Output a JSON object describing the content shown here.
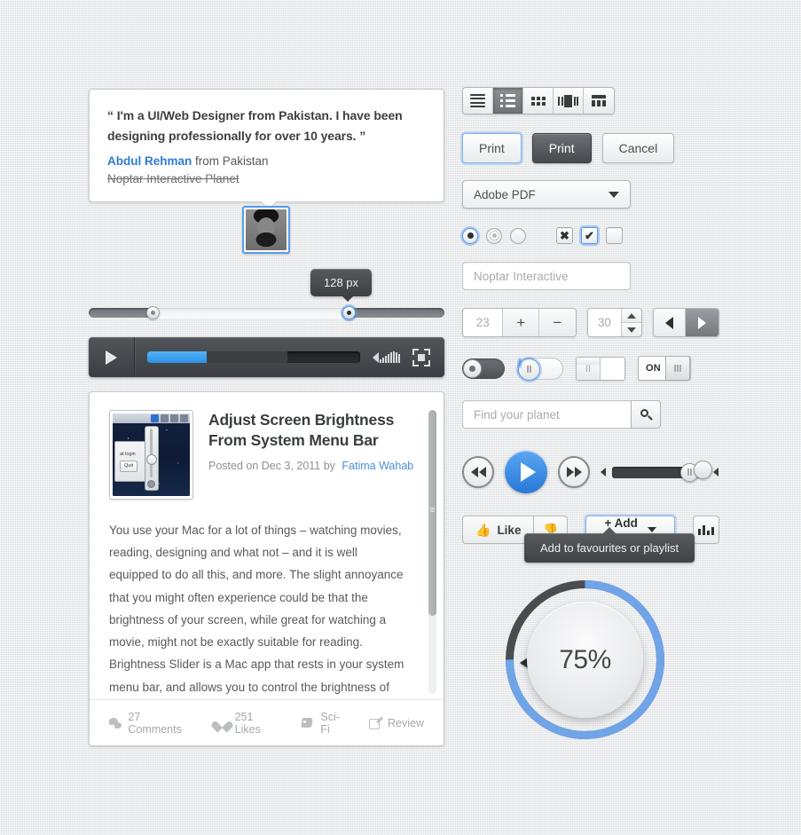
{
  "quote": {
    "text": "“ I'm a UI/Web Designer from Pakistan. I have been designing professionally for over 10 years. ”",
    "author_name": "Abdul Rehman",
    "author_from": "from Pakistan",
    "site": "Noptar Interactive Planet"
  },
  "range_slider": {
    "tooltip_value": "128 px",
    "left_handle_percent": 18,
    "right_handle_percent": 73
  },
  "player": {
    "progress_percent": 28,
    "buffer_percent": 66
  },
  "article": {
    "title": "Adjust Screen Brightness From System Menu Bar",
    "meta_prefix": "Posted on Dec 3, 2011 by",
    "author": "Fatima Wahab",
    "body": "You use your Mac for a lot of things – watching movies, reading, designing and what not – and it is well equipped to do all this, and more. The slight annoyance that you might often experience could be that the brightness of your screen, while great for watching a movie, might not be exactly suitable for reading. Brightness Slider is a Mac app that rests in your system menu bar, and allows you to control the brightness of your screen.",
    "thumb_caption_1": "at login",
    "thumb_caption_2": "Quit",
    "footer": [
      {
        "icon": "comment-icon",
        "label": "27 Comments"
      },
      {
        "icon": "heart-icon",
        "label": "251 Likes"
      },
      {
        "icon": "tag-icon",
        "label": "Sci-Fi"
      },
      {
        "icon": "edit-icon",
        "label": "Review"
      }
    ]
  },
  "view_modes": [
    {
      "name": "list-view",
      "active": false
    },
    {
      "name": "detail-list-view",
      "active": true
    },
    {
      "name": "grid-view",
      "active": false
    },
    {
      "name": "coverflow-view",
      "active": false
    },
    {
      "name": "calendar-view",
      "active": false
    }
  ],
  "buttons": {
    "print_focus": "Print",
    "print_dark": "Print",
    "cancel": "Cancel"
  },
  "select": {
    "value": "Adobe PDF",
    "options": [
      "Adobe PDF"
    ]
  },
  "choices": {
    "radios": [
      {
        "name": "radio-selected-focused",
        "state": "selected"
      },
      {
        "name": "radio-selected-gray",
        "state": "selected-gray"
      },
      {
        "name": "radio-empty",
        "state": "empty"
      }
    ],
    "checkboxes": [
      {
        "name": "checkbox-mixed",
        "glyph": "✖"
      },
      {
        "name": "checkbox-checked",
        "glyph": "✔"
      },
      {
        "name": "checkbox-empty",
        "glyph": ""
      }
    ]
  },
  "textfield": {
    "placeholder": "Noptar Interactive"
  },
  "stepper": {
    "value": "23",
    "plus": "+",
    "minus": "−"
  },
  "spinner": {
    "value": "30"
  },
  "nav": {
    "prev_name": "prev-button",
    "next_name": "next-button"
  },
  "toggles": [
    {
      "name": "toggle-dark-knob",
      "state": "off"
    },
    {
      "name": "toggle-pill-focused",
      "state": "off"
    },
    {
      "name": "toggle-square-grip",
      "state": "off"
    },
    {
      "name": "toggle-on-label",
      "label": "ON",
      "state": "on"
    }
  ],
  "search": {
    "placeholder": "Find your planet",
    "icon": "search-icon"
  },
  "media": {
    "rewind_icon": "rewind-icon",
    "play_icon": "play-icon",
    "forward_icon": "forward-icon",
    "volume_percent": 78
  },
  "social": {
    "like_label": "Like",
    "dislike_name": "dislike-button",
    "add_to_label": "+ Add to",
    "stats_name": "stats-button",
    "tooltip": "Add to favourites or playlist"
  },
  "gauge": {
    "label": "75%",
    "percent": 75,
    "arc_color": "#6fa4e8",
    "track_color": "#4a4d50"
  }
}
